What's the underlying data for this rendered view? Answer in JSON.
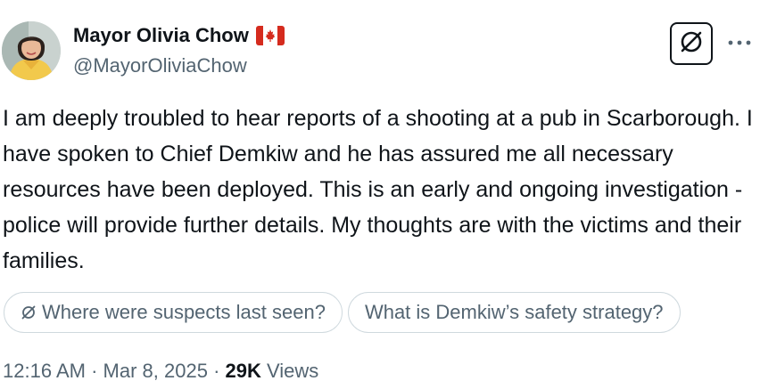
{
  "author": {
    "display_name": "Mayor Olivia Chow",
    "flag_icon": "canada-flag-icon",
    "handle": "@MayorOliviaChow"
  },
  "actions": {
    "grok_icon": "grok-icon",
    "more_icon": "more-dots-icon"
  },
  "tweet": {
    "text": "I am deeply troubled to hear reports of a shooting at a pub in Scarborough. I have spoken to Chief Demkiw and he has assured me all necessary resources have been deployed. This is an early and ongoing investigation - police will provide further details. My thoughts are with the victims and their families."
  },
  "suggestions": [
    {
      "label": "Where were suspects last seen?"
    },
    {
      "label": "What is Demkiw’s safety strategy?"
    }
  ],
  "meta": {
    "time": "12:16 AM",
    "separator": "·",
    "date": "Mar 8, 2025",
    "views_count": "29K",
    "views_label": "Views"
  },
  "colors": {
    "text_primary": "#0f1419",
    "text_secondary": "#536471",
    "border": "#cfd9de",
    "flag_red": "#d52b1e"
  }
}
